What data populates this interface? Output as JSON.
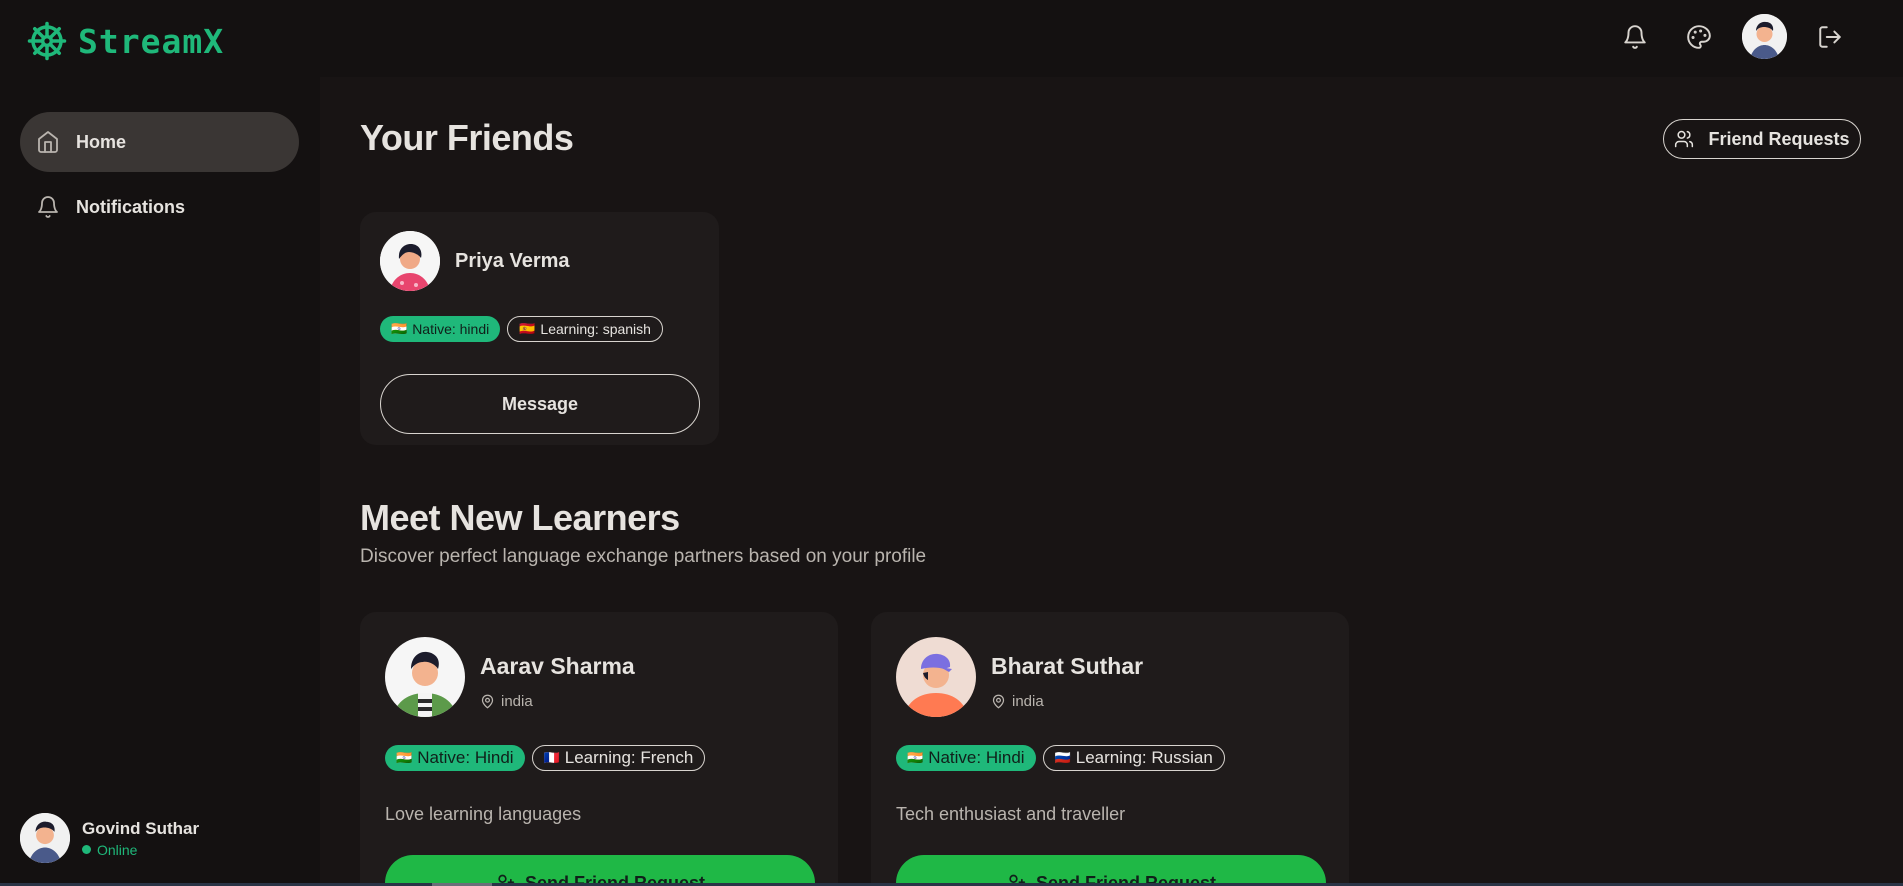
{
  "app": {
    "name": "StreamX",
    "accent": "#1fb87a"
  },
  "header": {
    "icons": [
      "bell-icon",
      "palette-icon",
      "avatar",
      "logout-icon"
    ]
  },
  "sidebar": {
    "items": [
      {
        "label": "Home",
        "icon": "home-icon",
        "active": true
      },
      {
        "label": "Notifications",
        "icon": "bell-icon",
        "active": false
      }
    ],
    "user": {
      "name": "Govind Suthar",
      "status": "Online"
    }
  },
  "friends": {
    "title": "Your Friends",
    "requests_label": "Friend Requests",
    "cards": [
      {
        "name": "Priya Verma",
        "native": "Native: hindi",
        "native_flag": "🇮🇳",
        "learning": "Learning: spanish",
        "learning_flag": "🇪🇸",
        "button": "Message"
      }
    ]
  },
  "learners": {
    "title": "Meet New Learners",
    "subtitle": "Discover perfect language exchange partners based on your profile",
    "cards": [
      {
        "name": "Aarav Sharma",
        "location": "india",
        "native": "Native: Hindi",
        "native_flag": "🇮🇳",
        "learning": "Learning: French",
        "learning_flag": "🇫🇷",
        "bio": "Love learning languages",
        "button": "Send Friend Request"
      },
      {
        "name": "Bharat Suthar",
        "location": "india",
        "native": "Native: Hindi",
        "native_flag": "🇮🇳",
        "learning": "Learning: Russian",
        "learning_flag": "🇷🇺",
        "bio": "Tech enthusiast and traveller",
        "button": "Send Friend Request"
      }
    ]
  }
}
